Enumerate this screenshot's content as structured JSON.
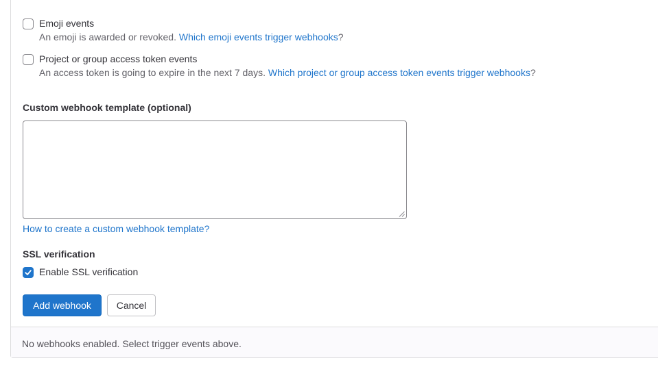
{
  "triggers": {
    "emoji": {
      "label": "Emoji events",
      "help": "An emoji is awarded or revoked. ",
      "link": "Which emoji events trigger webhooks",
      "suffix": "?",
      "checked": false
    },
    "access_token": {
      "label": "Project or group access token events",
      "help": "An access token is going to expire in the next 7 days. ",
      "link": "Which project or group access token events trigger webhooks",
      "suffix": "?",
      "checked": false
    }
  },
  "custom_template": {
    "label": "Custom webhook template (optional)",
    "value": "",
    "help_link": "How to create a custom webhook template?"
  },
  "ssl": {
    "title": "SSL verification",
    "checkbox_label": "Enable SSL verification",
    "checked": true
  },
  "actions": {
    "add_label": "Add webhook",
    "cancel_label": "Cancel"
  },
  "footer": {
    "status": "No webhooks enabled. Select trigger events above."
  },
  "colors": {
    "accent": "#1f75cb",
    "text": "#333238",
    "muted": "#626168",
    "border": "#dcdcde"
  },
  "icons": {
    "checkmark": "check-icon"
  }
}
